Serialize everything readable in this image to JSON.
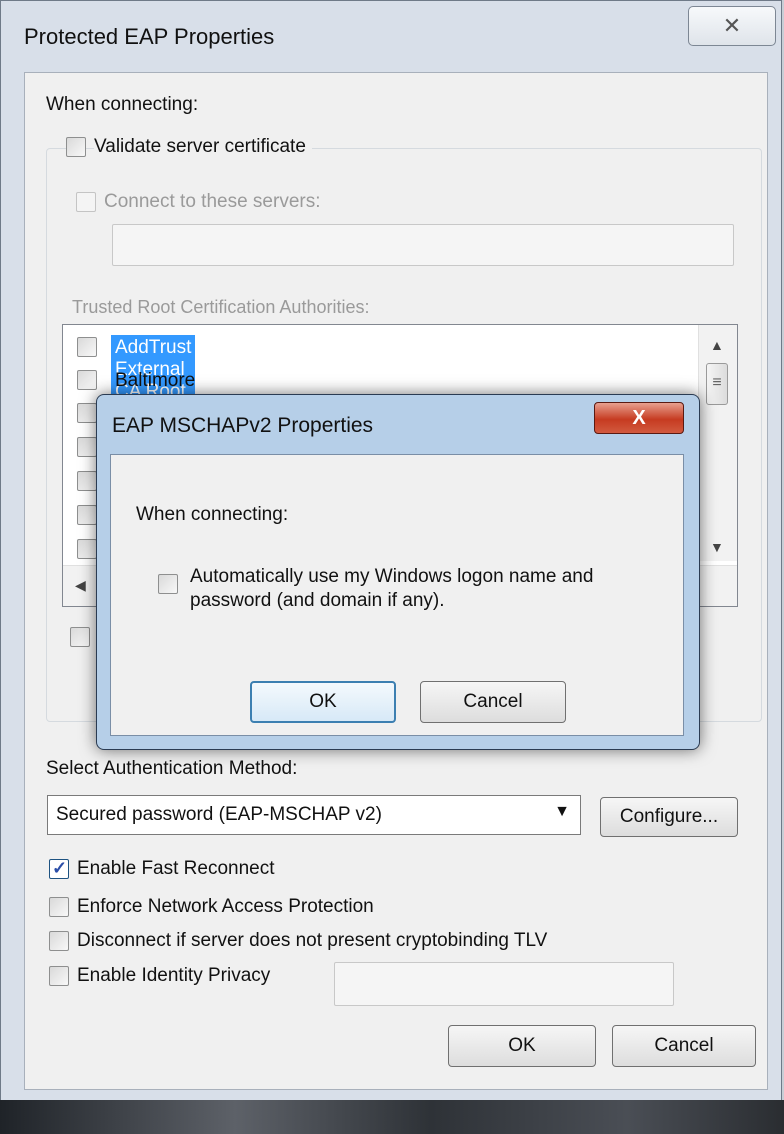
{
  "outer": {
    "title": "Protected EAP Properties",
    "close_glyph": "✕",
    "when_connecting": "When connecting:",
    "validate_cert": {
      "label": "Validate server certificate",
      "checked": false
    },
    "connect_servers": {
      "label": "Connect to these servers:",
      "checked": false,
      "value": ""
    },
    "trusted_root_label": "Trusted Root Certification Authorities:",
    "ca_list": [
      {
        "label": "AddTrust External CA Root",
        "checked": false,
        "selected": true
      },
      {
        "label": "Baltimore CyberTrust Root",
        "checked": false,
        "selected": false
      }
    ],
    "auth_method_label": "Select Authentication Method:",
    "auth_method_value": "Secured password (EAP-MSCHAP v2)",
    "configure_label": "Configure...",
    "options": [
      {
        "label": "Enable Fast Reconnect",
        "checked": true
      },
      {
        "label": "Enforce Network Access Protection",
        "checked": false
      },
      {
        "label": "Disconnect if server does not present cryptobinding TLV",
        "checked": false
      },
      {
        "label": "Enable Identity Privacy",
        "checked": false
      }
    ],
    "identity_value": "",
    "ok_label": "OK",
    "cancel_label": "Cancel"
  },
  "modal": {
    "title": "EAP MSCHAPv2 Properties",
    "close_glyph": "X",
    "when_connecting": "When connecting:",
    "auto_logon_line1": "Automatically use my Windows logon name and",
    "auto_logon_line2": "password (and domain if any).",
    "auto_logon_checked": false,
    "ok_label": "OK",
    "cancel_label": "Cancel"
  },
  "icons": {
    "scroll_up": "▲",
    "scroll_down": "▼",
    "scroll_left": "◀",
    "dropdown": "▼",
    "scroll_thumb": "≡"
  }
}
